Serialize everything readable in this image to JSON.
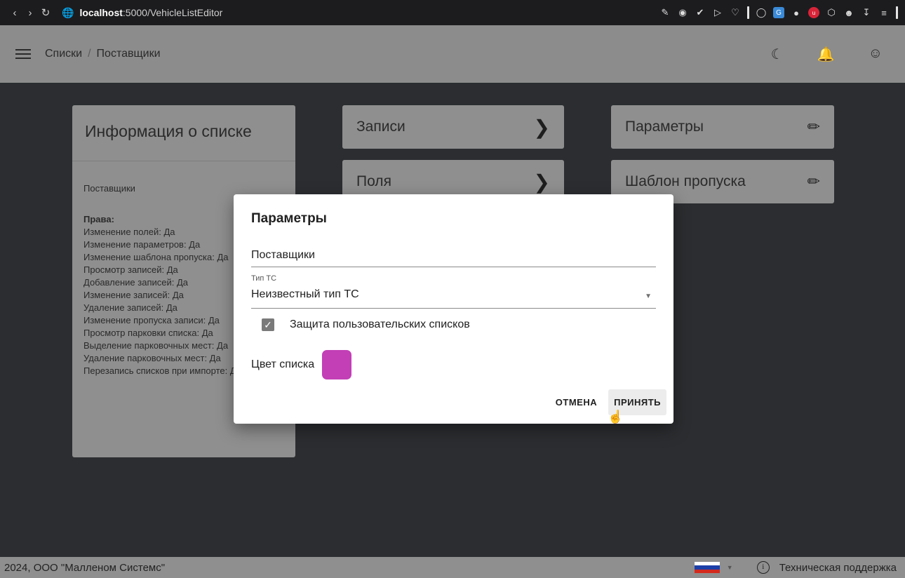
{
  "browser": {
    "url_host": "localhost",
    "url_path": ":5000/VehicleListEditor",
    "icons": [
      "back-icon",
      "forward-icon",
      "reload-icon",
      "globe-icon"
    ]
  },
  "app_bar": {
    "breadcrumb": [
      "Списки",
      "Поставщики"
    ],
    "separator": "/",
    "icons": [
      "theme-moon-icon",
      "bell-icon",
      "account-icon"
    ]
  },
  "info_card": {
    "title": "Информация о списке",
    "list_name": "Поставщики",
    "rights_heading": "Права:",
    "rights": [
      "Изменение полей: Да",
      "Изменение параметров: Да",
      "Изменение шаблона пропуска: Да",
      "Просмотр записей: Да",
      "Добавление записей: Да",
      "Изменение записей: Да",
      "Удаление записей: Да",
      "Изменение пропуска записи: Да",
      "Просмотр парковки списка: Да",
      "Выделение парковочных мест: Да",
      "Удаление парковочных мест: Да",
      "Перезапись списков при импорте: Да"
    ]
  },
  "nav_cards": {
    "records": "Записи",
    "fields": "Поля",
    "parameters": "Параметры",
    "pass_template": "Шаблон пропуска"
  },
  "modal": {
    "title": "Параметры",
    "name_value": "Поставщики",
    "vehicle_type_label": "Тип ТС",
    "vehicle_type_value": "Неизвестный тип ТС",
    "protection_label": "Защита пользовательских списков",
    "protection_checked": true,
    "color_label": "Цвет списка",
    "color_value": "#c23fb6",
    "cancel_label": "ОТМЕНА",
    "accept_label": "ПРИНЯТЬ"
  },
  "footer": {
    "copyright": "2024, ООО \"Малленом Системс\"",
    "support_label": "Техническая поддержка",
    "flag_colors": [
      "#ffffff",
      "#1c3fa8",
      "#d42a1e"
    ]
  }
}
